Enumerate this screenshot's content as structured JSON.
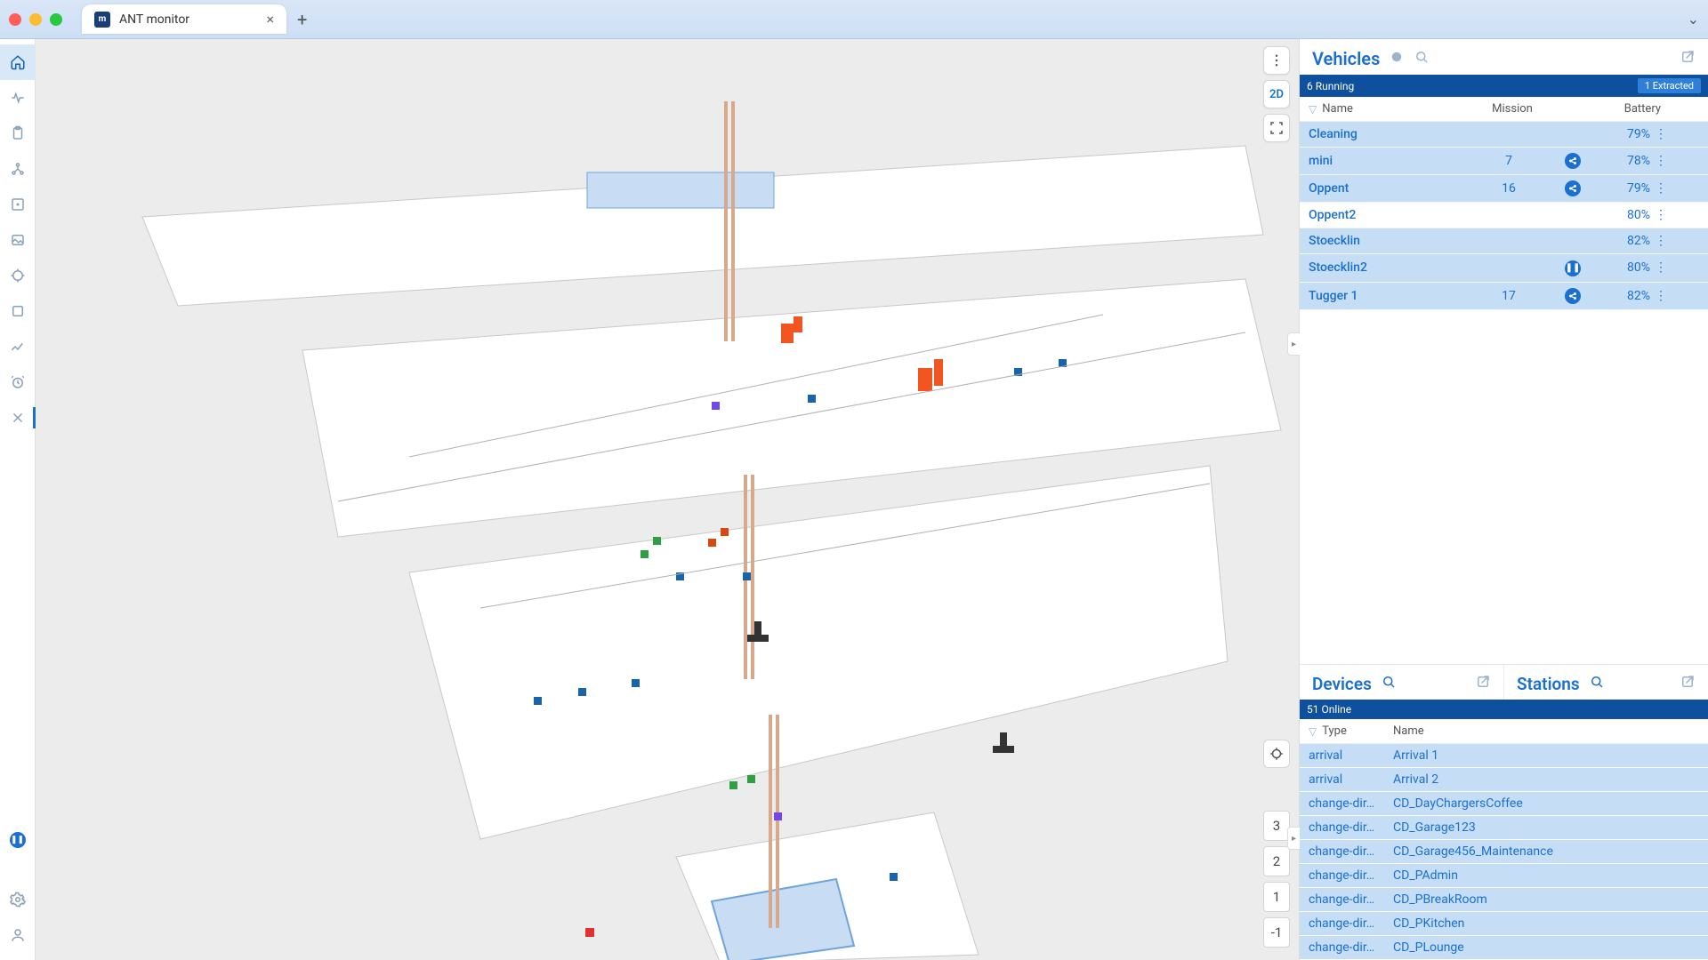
{
  "browser": {
    "tab_title": "ANT monitor"
  },
  "sidebar": {
    "items": [
      "home",
      "health",
      "clipboard",
      "nodes",
      "layout",
      "image",
      "locate",
      "square",
      "chart",
      "alarm",
      "tools"
    ]
  },
  "map_controls": {
    "view_mode": "2D",
    "floors": [
      "3",
      "2",
      "1",
      "-1"
    ]
  },
  "vehicles_panel": {
    "title": "Vehicles",
    "status_running": "6 Running",
    "status_extracted": "1 Extracted",
    "columns": {
      "name": "Name",
      "mission": "Mission",
      "battery": "Battery"
    },
    "rows": [
      {
        "name": "Cleaning",
        "mission": "",
        "icon": "",
        "battery": "79%",
        "selected": true
      },
      {
        "name": "mini",
        "mission": "7",
        "icon": "share",
        "battery": "78%",
        "selected": true
      },
      {
        "name": "Oppent",
        "mission": "16",
        "icon": "share",
        "battery": "79%",
        "selected": true
      },
      {
        "name": "Oppent2",
        "mission": "",
        "icon": "",
        "battery": "80%",
        "selected": false
      },
      {
        "name": "Stoecklin",
        "mission": "",
        "icon": "",
        "battery": "82%",
        "selected": true
      },
      {
        "name": "Stoecklin2",
        "mission": "",
        "icon": "pause",
        "battery": "80%",
        "selected": true
      },
      {
        "name": "Tugger 1",
        "mission": "17",
        "icon": "share",
        "battery": "82%",
        "selected": true
      }
    ]
  },
  "devices_panel": {
    "title_devices": "Devices",
    "title_stations": "Stations",
    "status_online": "51 Online",
    "columns": {
      "type": "Type",
      "name": "Name"
    },
    "rows": [
      {
        "type": "arrival",
        "name": "Arrival 1"
      },
      {
        "type": "arrival",
        "name": "Arrival 2"
      },
      {
        "type": "change-dir…",
        "name": "CD_DayChargersCoffee"
      },
      {
        "type": "change-dir…",
        "name": "CD_Garage123"
      },
      {
        "type": "change-dir…",
        "name": "CD_Garage456_Maintenance"
      },
      {
        "type": "change-dir…",
        "name": "CD_PAdmin"
      },
      {
        "type": "change-dir…",
        "name": "CD_PBreakRoom"
      },
      {
        "type": "change-dir…",
        "name": "CD_PKitchen"
      },
      {
        "type": "change-dir…",
        "name": "CD_PLounge"
      }
    ]
  }
}
